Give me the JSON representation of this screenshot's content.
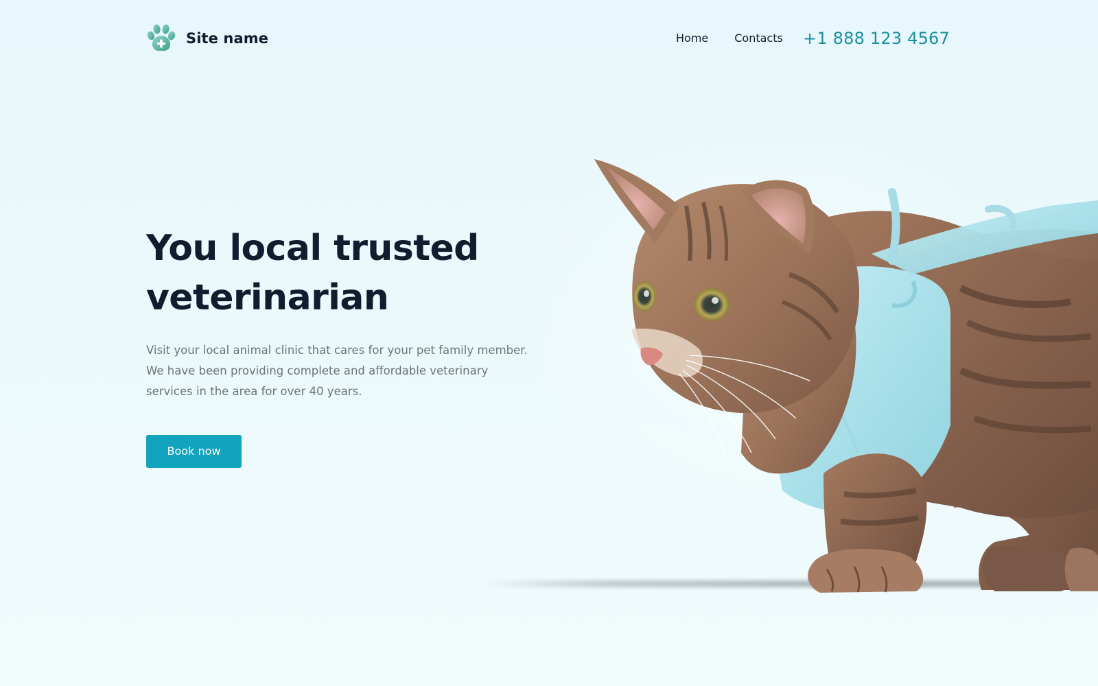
{
  "header": {
    "site_name": "Site name",
    "logo_icon": "paw-plus-icon",
    "nav": [
      {
        "label": "Home"
      },
      {
        "label": "Contacts"
      }
    ],
    "phone": "+1 888 123 4567"
  },
  "hero": {
    "title_line1": "You local trusted",
    "title_line2": "veterinarian",
    "lead": "Visit your local animal clinic that cares for your pet family member. We have been providing complete and affordable veterinary services in the area for over 40 years.",
    "cta_label": "Book now"
  },
  "image": {
    "subject": "cat-in-surgical-vest-photo"
  },
  "colors": {
    "accent": "#12a3be",
    "phone": "#1a8fa3",
    "text_dark": "#0f1d2e",
    "text_muted": "#6a747c",
    "background": "#e9f8fb"
  }
}
